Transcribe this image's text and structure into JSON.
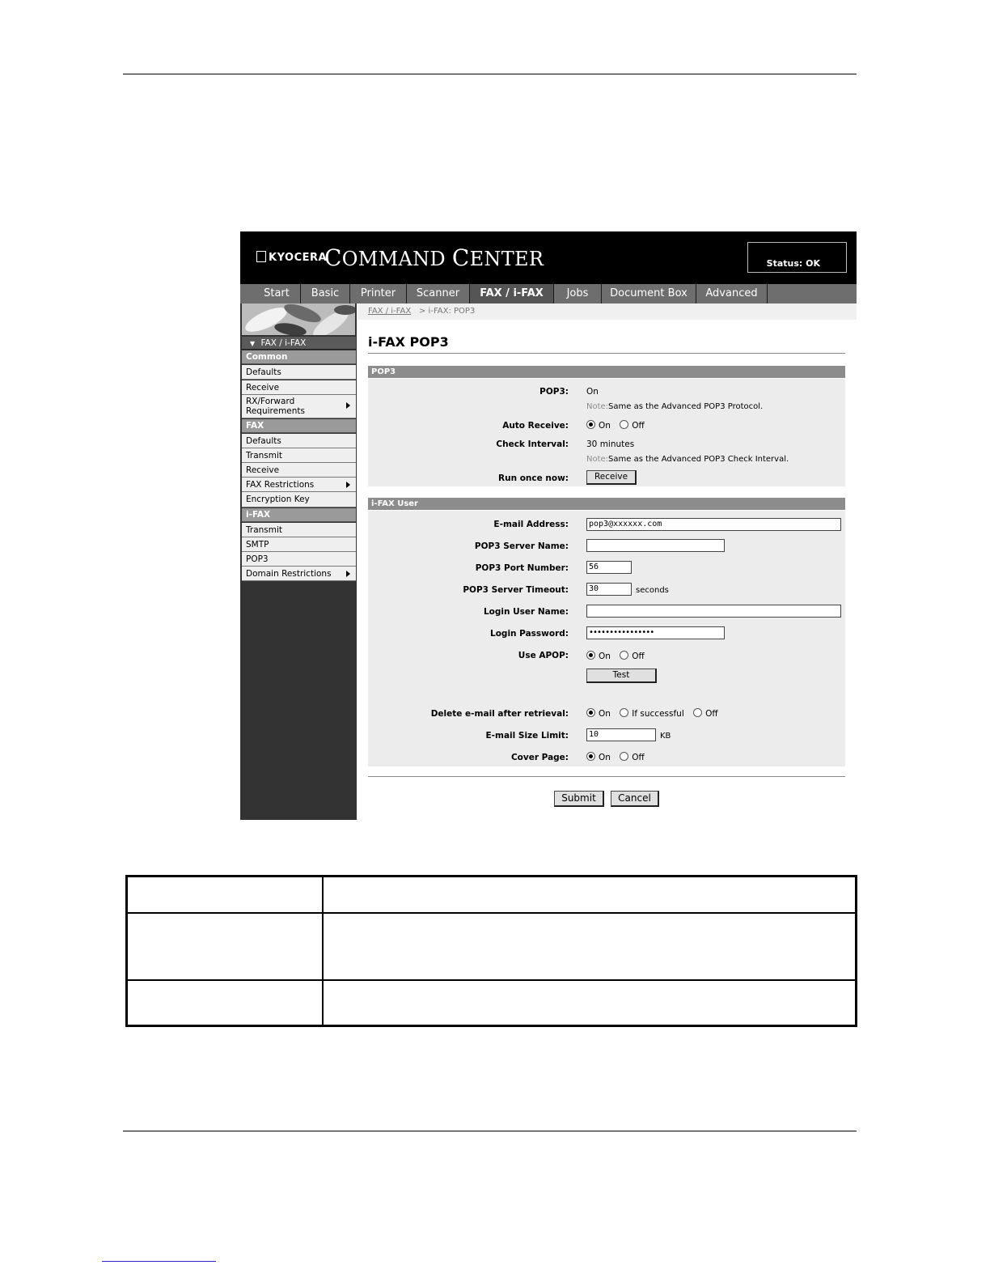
{
  "banner": {
    "logo": "KYOCERA",
    "title_c1": "C",
    "title_rest1": "OMMAND ",
    "title_c2": "C",
    "title_rest2": "ENTER",
    "status": "Status: OK"
  },
  "tabs": [
    "Start",
    "Basic",
    "Printer",
    "Scanner",
    "FAX / i-FAX",
    "Jobs",
    "Document Box",
    "Advanced"
  ],
  "sidebar": {
    "top": "FAX / i-FAX",
    "common_header": "Common",
    "common_items": [
      "Defaults",
      "Receive"
    ],
    "rx_line1": "RX/Forward",
    "rx_line2": "Requirements",
    "fax_header": "FAX",
    "fax_items": [
      "Defaults",
      "Transmit",
      "Receive",
      "FAX Restrictions",
      "Encryption Key"
    ],
    "ifax_header": "i-FAX",
    "ifax_items": [
      "Transmit",
      "SMTP",
      "POP3",
      "Domain Restrictions"
    ]
  },
  "breadcrumb": {
    "link": "FAX / i-FAX",
    "current": "> i-FAX: POP3"
  },
  "page_title": "i-FAX POP3",
  "pop3_section": {
    "header": "POP3",
    "pop3_label": "POP3:",
    "pop3_value": "On",
    "note_key": "Note:",
    "note1": "Same as the Advanced POP3 Protocol.",
    "auto_receive_label": "Auto Receive:",
    "on_label": "On",
    "off_label": "Off",
    "check_interval_label": "Check Interval:",
    "check_interval_value": "30 minutes",
    "note2": "Same as the Advanced POP3 Check Interval.",
    "run_once_label": "Run once now:",
    "receive_button": "Receive"
  },
  "user_section": {
    "header": "i-FAX User",
    "email_label": "E-mail Address:",
    "email_value": "pop3@xxxxxx.com",
    "server_name_label": "POP3 Server Name:",
    "server_name_value": "",
    "port_label": "POP3 Port Number:",
    "port_value": "56",
    "timeout_label": "POP3 Server Timeout:",
    "timeout_value": "30",
    "timeout_unit": "seconds",
    "login_user_label": "Login User Name:",
    "login_user_value": "",
    "password_label": "Login Password:",
    "password_value": "••••••••••••••••",
    "apop_label": "Use APOP:",
    "test_button": "Test",
    "delete_label": "Delete e-mail after retrieval:",
    "if_successful_label": "If successful",
    "size_limit_label": "E-mail Size Limit:",
    "size_limit_value": "10",
    "size_unit": "KB",
    "cover_page_label": "Cover Page:"
  },
  "actions": {
    "submit": "Submit",
    "cancel": "Cancel"
  }
}
